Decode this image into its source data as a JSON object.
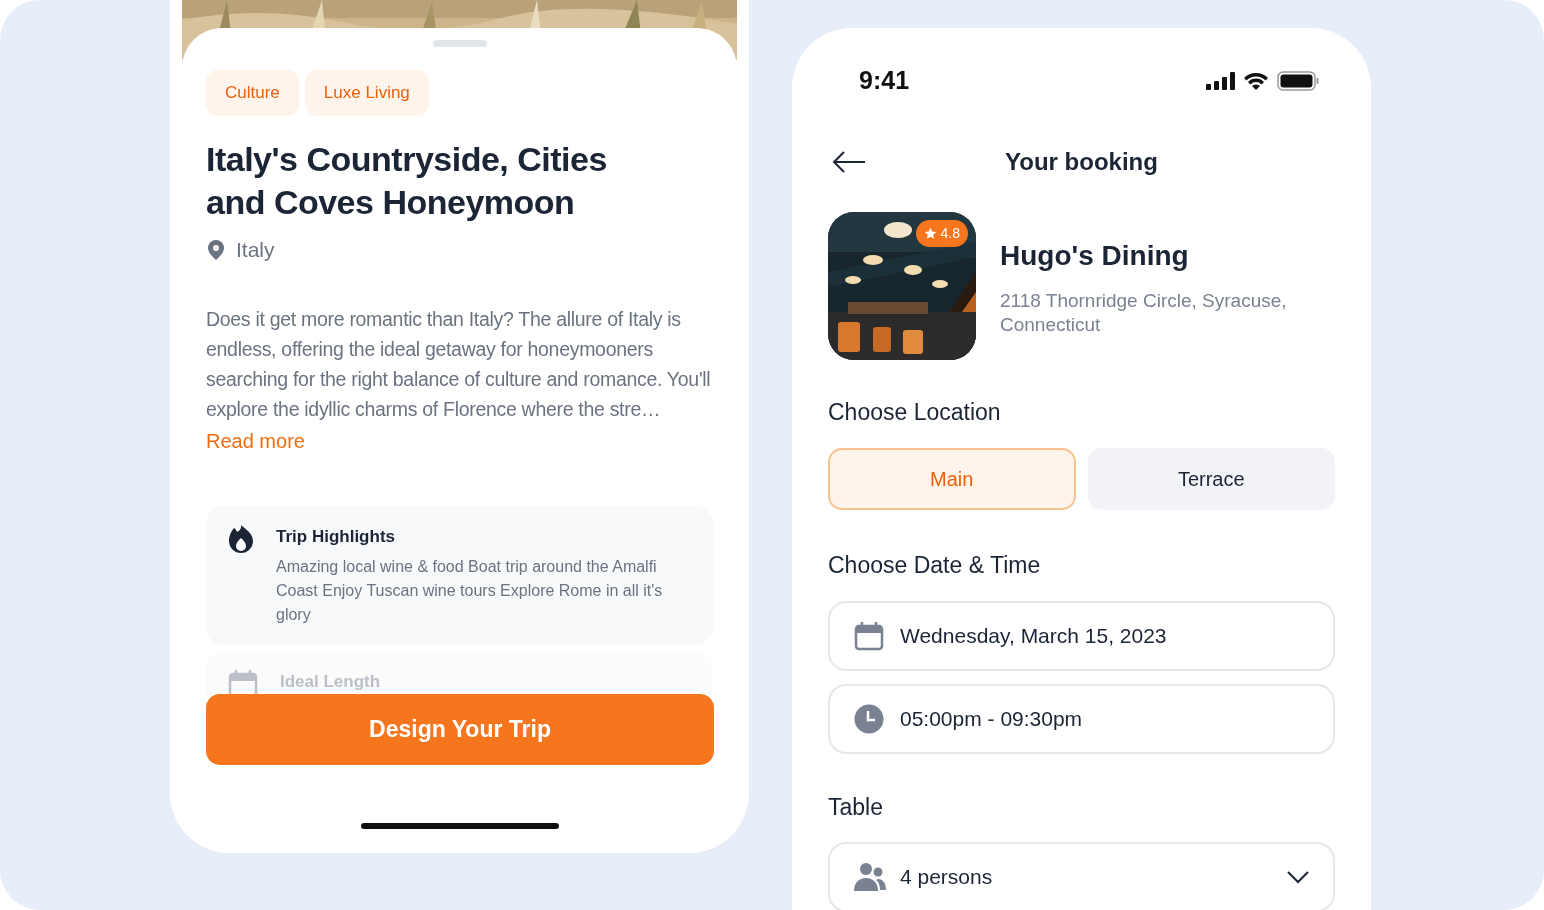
{
  "trip": {
    "tags": [
      "Culture",
      "Luxe Living"
    ],
    "title": "Italy's Countryside, Cities and Coves Honeymoon",
    "location": "Italy",
    "description": "Does it get more romantic than Italy? The allure of Italy is endless, offering the ideal getaway for honeymooners searching for the right balance of culture and romance. You'll explore the idyllic charms of Florence where the stre…",
    "read_more": "Read more",
    "sections": [
      {
        "kind": "highlights",
        "title": "Trip Highlights",
        "text": "Amazing local wine & food Boat trip around the Amalfi Coast Enjoy Tuscan wine tours Explore Rome in all it's glory"
      },
      {
        "kind": "length",
        "title": "Ideal Length"
      }
    ],
    "cta": "Design Your Trip"
  },
  "booking": {
    "status_bar": {
      "time": "9:41"
    },
    "title": "Your booking",
    "venue": {
      "rating": "4.8",
      "name": "Hugo's Dining",
      "address": "2118 Thornridge Circle, Syracuse, Connecticut"
    },
    "location_label": "Choose Location",
    "locations": [
      {
        "label": "Main",
        "selected": true
      },
      {
        "label": "Terrace",
        "selected": false
      }
    ],
    "datetime_label": "Choose Date & Time",
    "date": "Wednesday, March 15, 2023",
    "time": "05:00pm - 09:30pm",
    "table_label": "Table",
    "table": "4 persons"
  }
}
